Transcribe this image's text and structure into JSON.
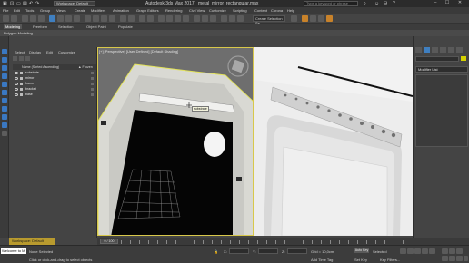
{
  "titlebar": {
    "workspace": "Workspace: Default",
    "app_title": "Autodesk 3ds Max 2017",
    "file_name": "metal_mirror_rectangular.max",
    "search_placeholder": "Type a keyword or phrase",
    "minimize": "–",
    "maximize": "☐",
    "close": "✕"
  },
  "menu": [
    "File",
    "Edit",
    "Tools",
    "Group",
    "Views",
    "Create",
    "Modifiers",
    "Animation",
    "Graph Editors",
    "Rendering",
    "Civil View",
    "Customize",
    "Scripting",
    "Content",
    "Corona",
    "Help"
  ],
  "toolbar": {
    "selection_set": "Create Selection Se"
  },
  "ribbon": {
    "tabs": [
      "Modeling",
      "Freeform",
      "Selection",
      "Object Paint",
      "Populate"
    ],
    "active_tab": "Modeling",
    "sub_label": "Polygon Modeling"
  },
  "explorer": {
    "menu": [
      "Select",
      "Display",
      "Edit",
      "Customize"
    ],
    "column_name": "Name (Sorted Ascending)",
    "column_frozen": "▲ Frozen",
    "items": [
      "substrate",
      "mirror",
      "frame",
      "bracket",
      "base"
    ]
  },
  "viewport": {
    "label": "[+] [Perspective] [User Defined] [Default Shading]",
    "tooltip": "substrate"
  },
  "command_panel": {
    "modifier_list": "Modifier List"
  },
  "bottom": {
    "workspace": "Workspace: Default",
    "frame_counter": "0 / 100"
  },
  "status": {
    "maxscript": "Welcome to M",
    "selection": "None Selected",
    "prompt": "Click or click-and-drag to select objects",
    "x_label": "X:",
    "y_label": "Y:",
    "z_label": "Z:",
    "grid": "Grid = 10,0cm",
    "add_time_tag": "Add Time Tag",
    "auto_key": "Auto Key",
    "set_key": "Set Key",
    "selected": "Selected",
    "key_filters": "Key Filters..."
  },
  "colors": {
    "accent_yellow": "#d8c84a",
    "workspace_gold": "#b89a2e",
    "object_color": "#d4d100",
    "selection_blue": "#3f7fc0"
  }
}
